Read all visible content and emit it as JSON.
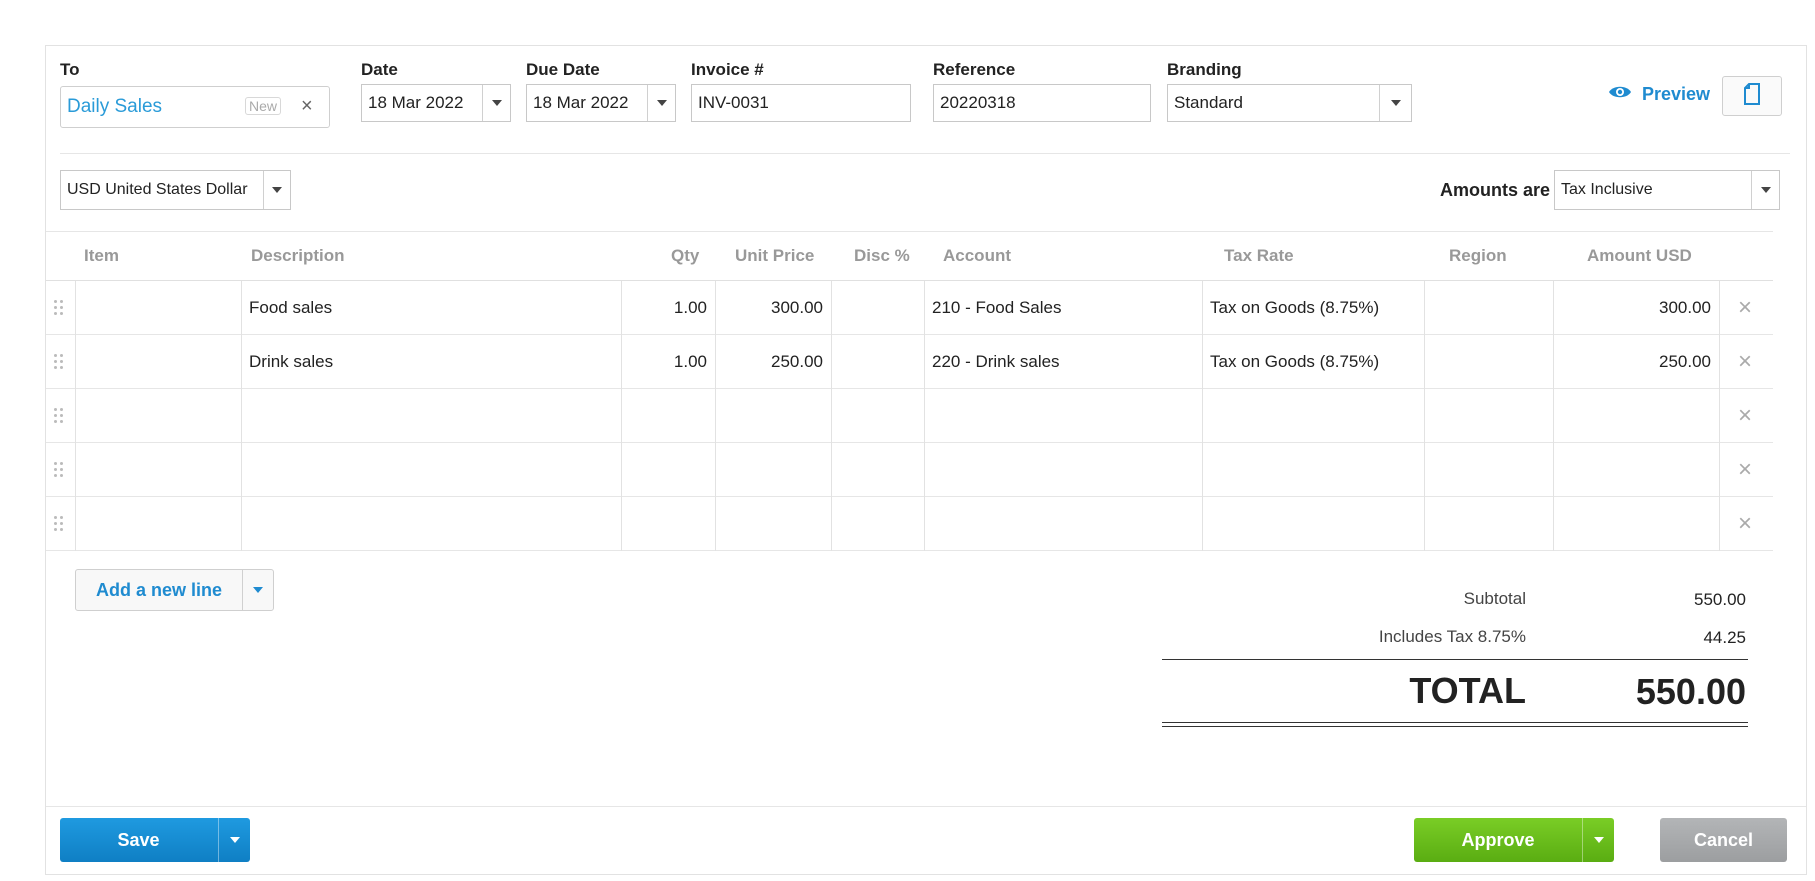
{
  "header": {
    "to_label": "To",
    "contact_name": "Daily Sales",
    "contact_badge": "New",
    "clear_glyph": "×",
    "date_label": "Date",
    "date_value": "18 Mar 2022",
    "due_date_label": "Due Date",
    "due_date_value": "18 Mar 2022",
    "invoice_label": "Invoice #",
    "invoice_value": "INV-0031",
    "reference_label": "Reference",
    "reference_value": "20220318",
    "branding_label": "Branding",
    "branding_value": "Standard",
    "preview_label": "Preview"
  },
  "options": {
    "currency": "USD United States Dollar",
    "amounts_are_label": "Amounts are",
    "amounts_are_value": "Tax Inclusive"
  },
  "table": {
    "columns": [
      "Item",
      "Description",
      "Qty",
      "Unit Price",
      "Disc %",
      "Account",
      "Tax Rate",
      "Region",
      "Amount USD"
    ],
    "rows": [
      {
        "item": "",
        "description": "Food sales",
        "qty": "1.00",
        "unit_price": "300.00",
        "disc": "",
        "account": "210 - Food Sales",
        "tax_rate": "Tax on Goods (8.75%)",
        "region": "",
        "amount": "300.00"
      },
      {
        "item": "",
        "description": "Drink sales",
        "qty": "1.00",
        "unit_price": "250.00",
        "disc": "",
        "account": "220 - Drink sales",
        "tax_rate": "Tax on Goods (8.75%)",
        "region": "",
        "amount": "250.00"
      },
      {
        "item": "",
        "description": "",
        "qty": "",
        "unit_price": "",
        "disc": "",
        "account": "",
        "tax_rate": "",
        "region": "",
        "amount": ""
      },
      {
        "item": "",
        "description": "",
        "qty": "",
        "unit_price": "",
        "disc": "",
        "account": "",
        "tax_rate": "",
        "region": "",
        "amount": ""
      },
      {
        "item": "",
        "description": "",
        "qty": "",
        "unit_price": "",
        "disc": "",
        "account": "",
        "tax_rate": "",
        "region": "",
        "amount": ""
      }
    ],
    "remove_glyph": "×",
    "add_line_label": "Add a new line"
  },
  "totals": {
    "subtotal_label": "Subtotal",
    "subtotal_value": "550.00",
    "tax_label": "Includes Tax 8.75%",
    "tax_value": "44.25",
    "total_label": "TOTAL",
    "total_value": "550.00"
  },
  "footer": {
    "save_label": "Save",
    "approve_label": "Approve",
    "cancel_label": "Cancel"
  },
  "colors": {
    "accent_blue": "#1f8bd0",
    "save_blue": "#1a8fd6",
    "approve_green": "#6bbf1e",
    "cancel_gray": "#a7a9ab"
  },
  "icons": [
    "eye-icon",
    "document-icon",
    "grip-icon",
    "close-icon",
    "chevron-down-icon"
  ]
}
